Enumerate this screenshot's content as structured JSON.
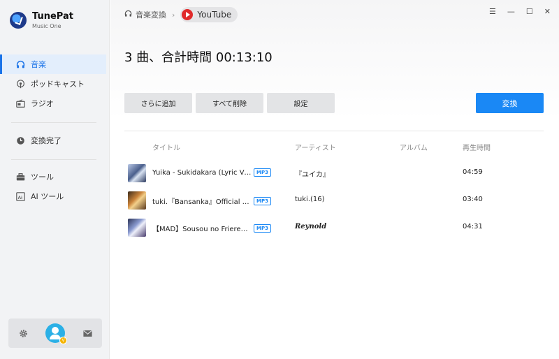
{
  "app": {
    "name": "TunePat",
    "subtitle": "Music One"
  },
  "sidebar": {
    "items": [
      {
        "label": "音楽",
        "icon": "headphones-icon",
        "active": true
      },
      {
        "label": "ポッドキャスト",
        "icon": "podcast-icon",
        "active": false
      },
      {
        "label": "ラジオ",
        "icon": "radio-icon",
        "active": false
      },
      {
        "label": "変換完了",
        "icon": "clock-icon",
        "active": false
      },
      {
        "label": "ツール",
        "icon": "toolbox-icon",
        "active": false
      },
      {
        "label": "AI ツール",
        "icon": "ai-icon",
        "active": false
      }
    ],
    "bottom": {
      "settings_icon": "gear-icon",
      "avatar_icon": "user-avatar-icon",
      "avatar_badge": "V",
      "mail_icon": "mail-icon"
    }
  },
  "header": {
    "breadcrumb_label": "音楽変換",
    "breadcrumb_sep": "›",
    "source_label": "YouTube"
  },
  "window": {
    "menu": "☰",
    "minimize": "—",
    "maximize": "☐",
    "close": "✕"
  },
  "summary": "3 曲、合計時間 00:13:10",
  "toolbar": {
    "add_more": "さらに追加",
    "delete_all": "すべて削除",
    "settings": "設定",
    "convert": "変換"
  },
  "table": {
    "headers": {
      "title": "タイトル",
      "artist": "アーティスト",
      "album": "アルバム",
      "duration": "再生時間"
    },
    "rows": [
      {
        "title": "Yuika - Sukidakara (Lyric Video)",
        "format": "MP3",
        "artist": "『ユイカ』",
        "album": "",
        "duration": "04:59"
      },
      {
        "title": "tuki.『Bansanka』Official Music Video",
        "format": "MP3",
        "artist": "tuki.(16)",
        "album": "",
        "duration": "03:40"
      },
      {
        "title": "【MAD】Sousou no Frieren『 …",
        "format": "MP3",
        "artist": "Reynold",
        "album": "",
        "duration": "04:31"
      }
    ]
  },
  "colors": {
    "accent": "#1a88f5",
    "active_nav_bg": "#e3eefc",
    "sidebar_bg": "#f2f3f5"
  }
}
